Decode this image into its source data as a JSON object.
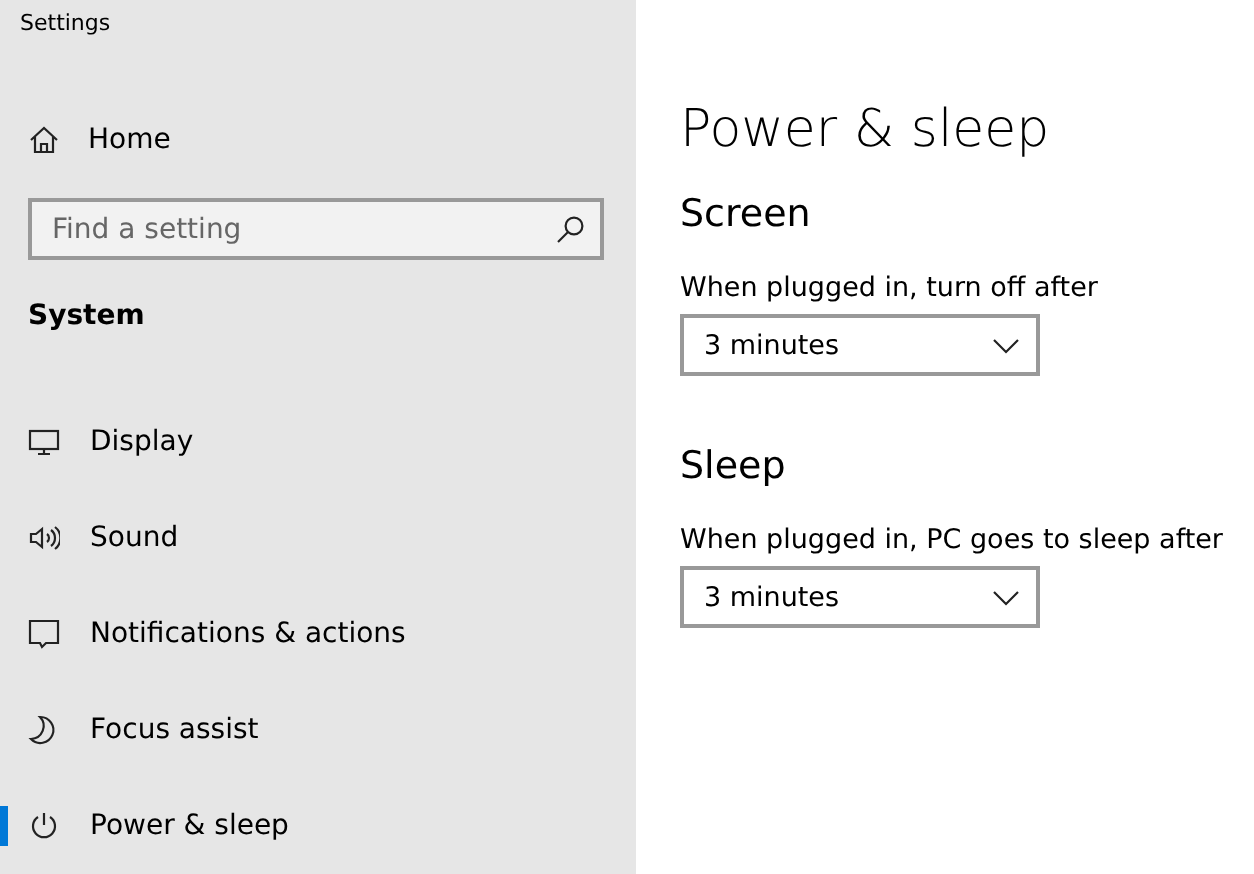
{
  "window": {
    "title": "Settings"
  },
  "sidebar": {
    "home": {
      "label": "Home"
    },
    "search": {
      "placeholder": "Find a setting"
    },
    "section": "System",
    "items": [
      {
        "label": "Display",
        "selected": false
      },
      {
        "label": "Sound",
        "selected": false
      },
      {
        "label": "Notifications & actions",
        "selected": false
      },
      {
        "label": "Focus assist",
        "selected": false
      },
      {
        "label": "Power & sleep",
        "selected": true
      }
    ]
  },
  "page": {
    "title": "Power & sleep",
    "sections": [
      {
        "heading": "Screen",
        "label": "When plugged in, turn off after",
        "value": "3 minutes"
      },
      {
        "heading": "Sleep",
        "label": "When plugged in, PC goes to sleep after",
        "value": "3 minutes"
      }
    ]
  }
}
